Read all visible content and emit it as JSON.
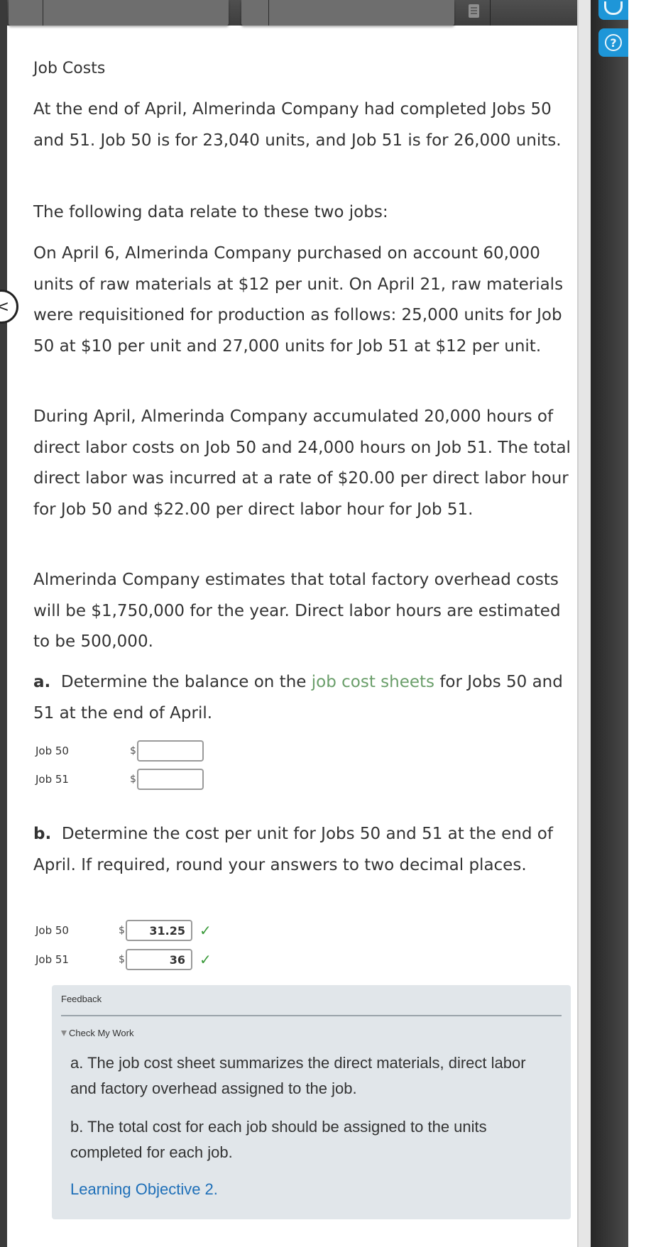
{
  "toolbar": {
    "tabs": [
      "",
      ""
    ],
    "icons": [
      "document-list-icon"
    ]
  },
  "sidebar": {
    "buttons": [
      {
        "icon": "headset-icon",
        "label": ""
      },
      {
        "icon": "help-icon",
        "label": "?"
      }
    ]
  },
  "navigation": {
    "back_icon": "chevron-left-icon",
    "back_glyph": "<"
  },
  "problem": {
    "title": "Job Costs",
    "paragraphs": [
      "At the end of April, Almerinda Company had completed Jobs 50 and 51. Job 50 is for 23,040 units, and Job 51 is for 26,000 units.",
      "The following data relate to these two jobs:",
      "On April 6, Almerinda Company purchased on account 60,000 units of raw materials at $12 per unit. On April 21, raw materials were requisitioned for production as follows: 25,000 units for Job 50 at $10 per unit and 27,000 units for Job 51 at $12 per unit.",
      "During April, Almerinda Company accumulated 20,000 hours of direct labor costs on Job 50 and 24,000 hours on Job 51. The total direct labor was incurred at a rate of $20.00 per direct labor hour for Job 50 and $22.00 per direct labor hour for Job 51.",
      "Almerinda Company estimates that total factory overhead costs will be $1,750,000 for the year. Direct labor hours are estimated to be 500,000."
    ],
    "part_a": {
      "label": "a.",
      "text_before": "Determine the balance on the",
      "link": "job cost sheets",
      "text_after": "for Jobs 50 and 51 at the end of April.",
      "link_color": "#6a9e6a",
      "rows": [
        {
          "label": "Job 50",
          "currency": "$",
          "value": ""
        },
        {
          "label": "Job 51",
          "currency": "$",
          "value": ""
        }
      ]
    },
    "part_b": {
      "label": "b.",
      "text": "Determine the cost per unit for Jobs 50 and 51 at the end of April. If required, round your answers to two decimal places.",
      "rows": [
        {
          "label": "Job 50",
          "currency": "$",
          "value": "31.25",
          "status": "correct",
          "status_glyph": "✓"
        },
        {
          "label": "Job 51",
          "currency": "$",
          "value": "36",
          "status": "correct",
          "status_glyph": "✓"
        }
      ],
      "correct_color": "#3a9a3a"
    }
  },
  "feedback": {
    "title": "Feedback",
    "toggle_label": "Check My Work",
    "items": [
      "a. The job cost sheet summarizes the direct materials, direct labor and factory overhead assigned to the job.",
      "b. The total cost for each job should be assigned to the units completed for each job."
    ],
    "link": "Learning Objective 2.",
    "link_color": "#1e6fb8",
    "background": "#e1e6ea"
  }
}
